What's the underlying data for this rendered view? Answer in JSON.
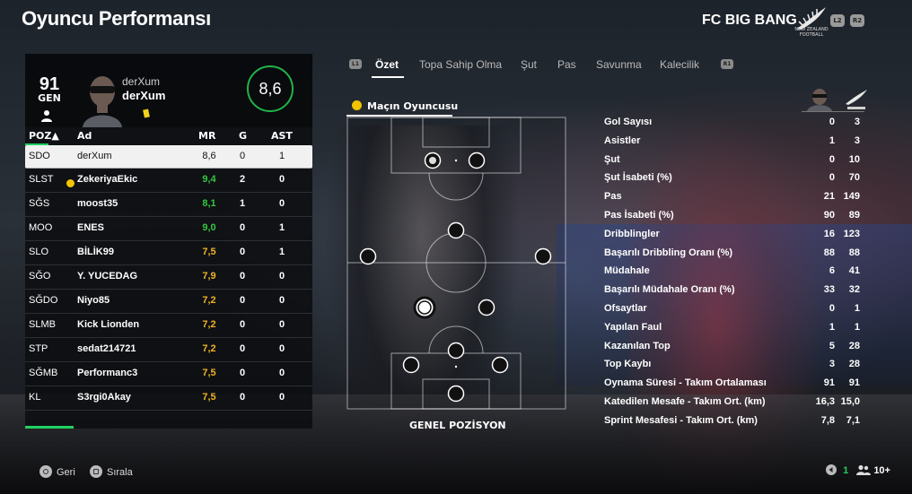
{
  "title": "Oyuncu Performansı",
  "club": {
    "name": "FC BIG BANG",
    "logo_text": "NEW ZEALAND FOOTBALL",
    "buttons": [
      "L2",
      "R2"
    ]
  },
  "player": {
    "overall": "91",
    "overall_label": "GEN",
    "name_line1": "derXum",
    "name_line2": "derXum",
    "rating": "8,6",
    "card": "yellow-card"
  },
  "table": {
    "headers": {
      "pos": "POZ▲",
      "name": "Ad",
      "mr": "MR",
      "g": "G",
      "ast": "AST"
    },
    "rows": [
      {
        "pos": "SDO",
        "name": "derXum",
        "mr": "8,6",
        "g": "0",
        "ast": "1",
        "mr_color": "#111111",
        "potm": false
      },
      {
        "pos": "SLST",
        "name": "ZekeriyaEkic",
        "mr": "9,4",
        "g": "2",
        "ast": "0",
        "mr_color": "#32c840",
        "potm": true
      },
      {
        "pos": "SĞS",
        "name": "moost35",
        "mr": "8,1",
        "g": "1",
        "ast": "0",
        "mr_color": "#32c840",
        "potm": false
      },
      {
        "pos": "MOO",
        "name": "ENES",
        "mr": "9,0",
        "g": "0",
        "ast": "1",
        "mr_color": "#32c840",
        "potm": false
      },
      {
        "pos": "SLO",
        "name": "BİLİK99",
        "mr": "7,5",
        "g": "0",
        "ast": "1",
        "mr_color": "#f0b323",
        "potm": false
      },
      {
        "pos": "SĞO",
        "name": "Y. YUCEDAG",
        "mr": "7,9",
        "g": "0",
        "ast": "0",
        "mr_color": "#f0b323",
        "potm": false
      },
      {
        "pos": "SĞDO",
        "name": "Niyo85",
        "mr": "7,2",
        "g": "0",
        "ast": "0",
        "mr_color": "#f0b323",
        "potm": false
      },
      {
        "pos": "SLMB",
        "name": "Kick Lionden",
        "mr": "7,2",
        "g": "0",
        "ast": "0",
        "mr_color": "#f0b323",
        "potm": false
      },
      {
        "pos": "STP",
        "name": "sedat214721",
        "mr": "7,2",
        "g": "0",
        "ast": "0",
        "mr_color": "#f0b323",
        "potm": false
      },
      {
        "pos": "SĞMB",
        "name": "Performanc3",
        "mr": "7,5",
        "g": "0",
        "ast": "0",
        "mr_color": "#f0b323",
        "potm": false
      },
      {
        "pos": "KL",
        "name": "S3rgi0Akay",
        "mr": "7,5",
        "g": "0",
        "ast": "0",
        "mr_color": "#f0b323",
        "potm": false
      }
    ]
  },
  "tabs": {
    "left_button": "L1",
    "right_button": "R1",
    "items": [
      "Özet",
      "Topa Sahip Olma",
      "Şut",
      "Pas",
      "Savunma",
      "Kalecilik"
    ],
    "active": "Özet"
  },
  "pitch": {
    "potm_label": "Maçın Oyuncusu",
    "caption": "GENEL POZİSYON"
  },
  "stats": {
    "rows": [
      {
        "label": "Gol Sayısı",
        "player": "0",
        "team": "3"
      },
      {
        "label": "Asistler",
        "player": "1",
        "team": "3"
      },
      {
        "label": "Şut",
        "player": "0",
        "team": "10"
      },
      {
        "label": "Şut İsabeti (%)",
        "player": "0",
        "team": "70"
      },
      {
        "label": "Pas",
        "player": "21",
        "team": "149"
      },
      {
        "label": "Pas İsabeti (%)",
        "player": "90",
        "team": "89"
      },
      {
        "label": "Dribblingler",
        "player": "16",
        "team": "123"
      },
      {
        "label": "Başarılı Dribbling Oranı (%)",
        "player": "88",
        "team": "88"
      },
      {
        "label": "Müdahale",
        "player": "6",
        "team": "41"
      },
      {
        "label": "Başarılı Müdahale Oranı (%)",
        "player": "33",
        "team": "32"
      },
      {
        "label": "Ofsaytlar",
        "player": "0",
        "team": "1"
      },
      {
        "label": "Yapılan Faul",
        "player": "1",
        "team": "1"
      },
      {
        "label": "Kazanılan Top",
        "player": "5",
        "team": "28"
      },
      {
        "label": "Top Kaybı",
        "player": "3",
        "team": "28"
      },
      {
        "label": "Oynama Süresi - Takım Ortalaması",
        "player": "91",
        "team": "91"
      },
      {
        "label": "Katedilen Mesafe - Takım Ort. (km)",
        "player": "16,3",
        "team": "15,0"
      },
      {
        "label": "Sprint Mesafesi - Takım Ort. (km)",
        "player": "7,8",
        "team": "7,1"
      }
    ]
  },
  "footer": {
    "back_label": "Geri",
    "sort_label": "Sırala",
    "page": "1",
    "players": "10+"
  }
}
